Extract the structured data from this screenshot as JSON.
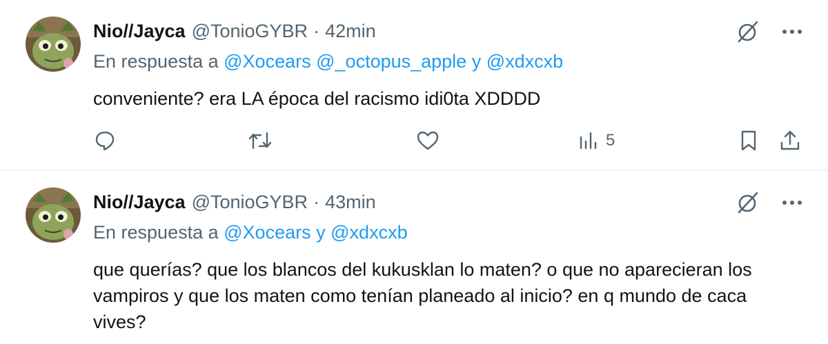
{
  "tweets": [
    {
      "name": "Nio//Jayca",
      "handle": "@TonioGYBR",
      "separator": "·",
      "time": "42min",
      "reply_prefix": "En respuesta a",
      "mentions": [
        "@Xocears",
        "@_octopus_apple",
        "@xdxcxb"
      ],
      "mention_joiner": "y",
      "text": "conveniente? era LA época del racismo idi0ta XDDDD",
      "views": "5"
    },
    {
      "name": "Nio//Jayca",
      "handle": "@TonioGYBR",
      "separator": "·",
      "time": "43min",
      "reply_prefix": "En respuesta a",
      "mentions": [
        "@Xocears",
        "@xdxcxb"
      ],
      "mention_joiner": "y",
      "text": "que querías? que los blancos del kukusklan lo maten? o que no aparecieran los vampiros y que los maten como tenían planeado al inicio? en q mundo de caca vives?"
    }
  ],
  "colors": {
    "text": "#0f1419",
    "secondary": "#536471",
    "mention": "#1d9bf0",
    "divider": "#eff3f4"
  },
  "icons": [
    "grok-icon",
    "more-icon",
    "reply-icon",
    "retweet-icon",
    "like-icon",
    "views-icon",
    "bookmark-icon",
    "share-icon"
  ]
}
